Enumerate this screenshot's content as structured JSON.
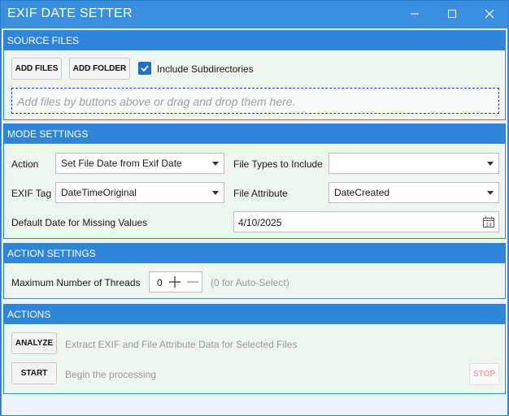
{
  "window": {
    "title": "EXIF DATE SETTER",
    "accent_color": "#3a8fe0",
    "buttons": {
      "minimize": "minimize-icon",
      "maximize": "maximize-icon",
      "close": "close-icon"
    }
  },
  "source_files": {
    "header": "SOURCE FILES",
    "add_files_label": "ADD FILES",
    "add_folder_label": "ADD FOLDER",
    "include_subdirectories": {
      "label": "Include Subdirectories",
      "checked": true
    },
    "dropzone_placeholder": "Add files by buttons above or drag and drop them here."
  },
  "mode_settings": {
    "header": "MODE SETTINGS",
    "action": {
      "label": "Action",
      "value": "Set File Date from Exif Date"
    },
    "file_types": {
      "label": "File Types to Include",
      "value": ""
    },
    "exif_tag": {
      "label": "EXIF Tag",
      "value": "DateTimeOriginal"
    },
    "file_attribute": {
      "label": "File Attribute",
      "value": "DateCreated"
    },
    "default_date": {
      "label": "Default Date for Missing Values",
      "value": "4/10/2025",
      "icon": "calendar-icon"
    }
  },
  "action_settings": {
    "header": "ACTION SETTINGS",
    "max_threads": {
      "label": "Maximum Number of Threads",
      "value": "0",
      "hint": "(0 for Auto-Select)"
    }
  },
  "actions": {
    "header": "ACTIONS",
    "analyze": {
      "label": "ANALYZE",
      "description": "Extract EXIF and File Attribute Data for Selected Files"
    },
    "start": {
      "label": "START",
      "description": "Begin the processing"
    },
    "stop": {
      "label": "STOP",
      "enabled": false
    }
  }
}
